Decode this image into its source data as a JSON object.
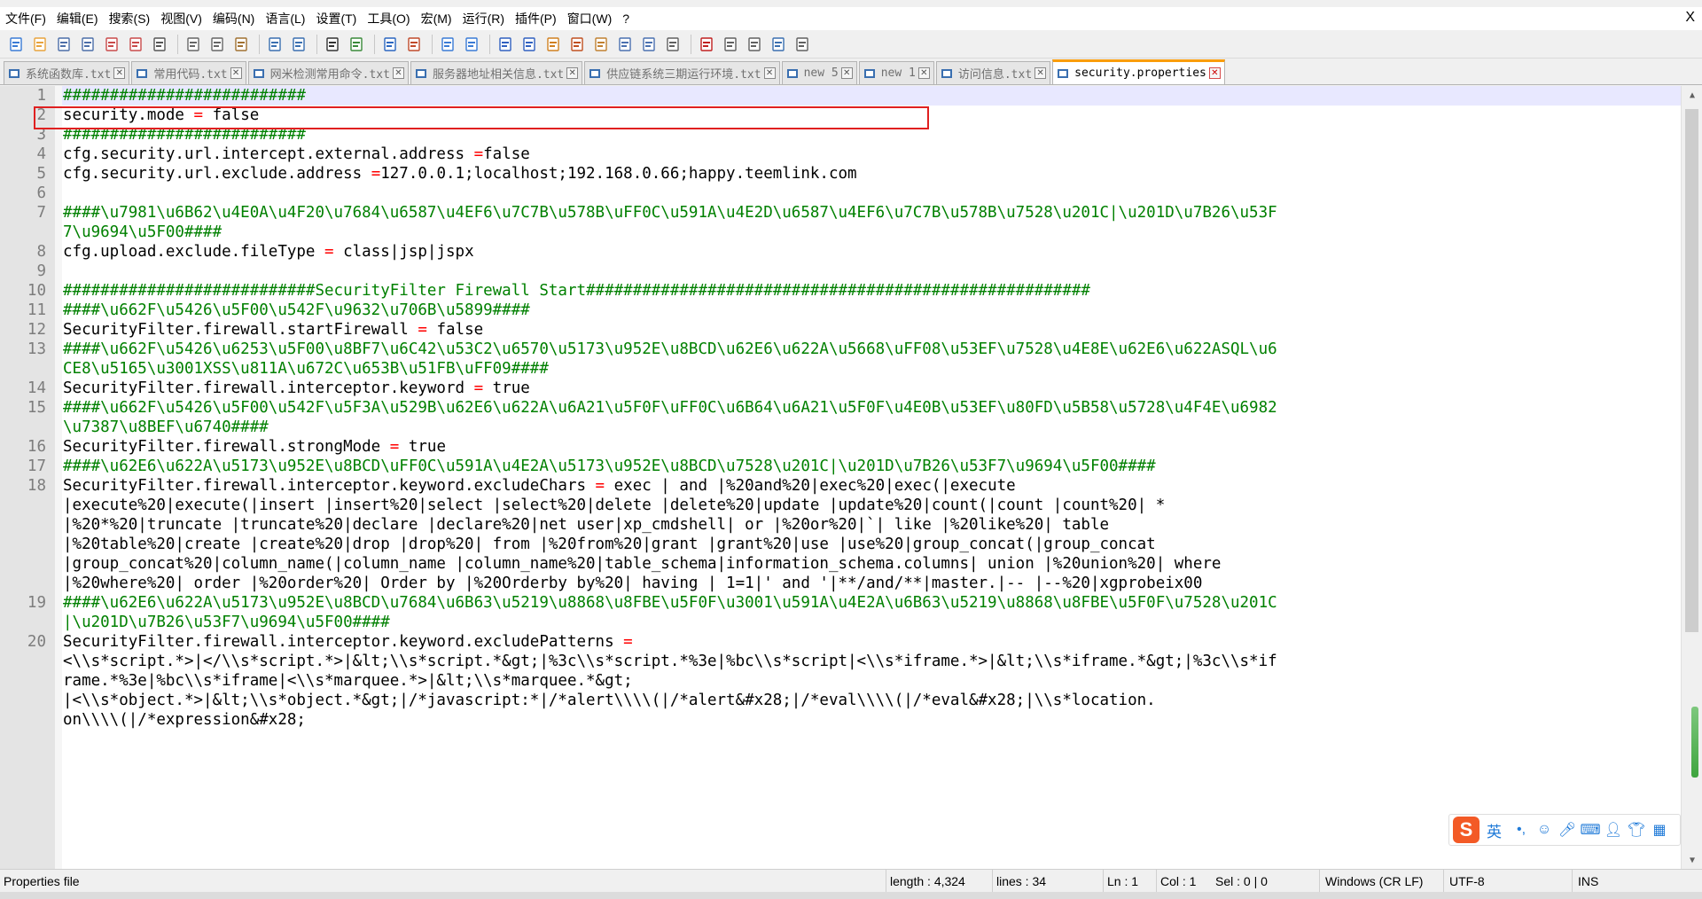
{
  "menubar": {
    "items": [
      "文件(F)",
      "编辑(E)",
      "搜索(S)",
      "视图(V)",
      "编码(N)",
      "语言(L)",
      "设置(T)",
      "工具(O)",
      "宏(M)",
      "运行(R)",
      "插件(P)",
      "窗口(W)",
      "?"
    ],
    "close": "X"
  },
  "toolbar": {
    "icons": [
      "new-file",
      "open-file",
      "save",
      "save-all",
      "close",
      "close-all",
      "print",
      "cut",
      "copy",
      "paste",
      "undo",
      "redo",
      "find",
      "replace",
      "zoom-in",
      "zoom-out",
      "sync-vertical",
      "sync-horizontal",
      "word-wrap",
      "show-all-chars",
      "indent-guide",
      "user-defined-language",
      "doc-map",
      "function-list",
      "folder-workspace",
      "monitoring",
      "record-macro",
      "stop-macro",
      "play-macro",
      "run-macro-multiple",
      "save-macro"
    ]
  },
  "tabs": [
    {
      "label": "系统函数库.txt",
      "active": false
    },
    {
      "label": "常用代码.txt",
      "active": false
    },
    {
      "label": "网米检测常用命令.txt",
      "active": false
    },
    {
      "label": "服务器地址相关信息.txt",
      "active": false
    },
    {
      "label": "供应链系统三期运行环境.txt",
      "active": false
    },
    {
      "label": "new 5",
      "active": false
    },
    {
      "label": "new 1",
      "active": false
    },
    {
      "label": "访问信息.txt",
      "active": false
    },
    {
      "label": "security.properties",
      "active": true
    }
  ],
  "editor": {
    "current_line": 1,
    "lines": [
      {
        "n": "1",
        "wrapped": [
          [
            [
              "c-comment",
              "##########################"
            ]
          ]
        ]
      },
      {
        "n": "2",
        "wrapped": [
          [
            [
              "c-key",
              "security.mode "
            ],
            [
              "c-op",
              "="
            ],
            [
              "c-val",
              " false"
            ]
          ]
        ]
      },
      {
        "n": "3",
        "wrapped": [
          [
            [
              "c-comment",
              "##########################"
            ]
          ]
        ]
      },
      {
        "n": "4",
        "wrapped": [
          [
            [
              "c-key",
              "cfg.security.url.intercept.external.address "
            ],
            [
              "c-op",
              "="
            ],
            [
              "c-val",
              "false"
            ]
          ]
        ]
      },
      {
        "n": "5",
        "wrapped": [
          [
            [
              "c-key",
              "cfg.security.url.exclude.address "
            ],
            [
              "c-op",
              "="
            ],
            [
              "c-val",
              "127.0.0.1;localhost;192.168.0.66;happy.teemlink.com"
            ]
          ]
        ]
      },
      {
        "n": "6",
        "wrapped": [
          [
            [
              "c-val",
              ""
            ]
          ]
        ]
      },
      {
        "n": "7",
        "wrapped": [
          [
            [
              "c-comment",
              "####\\u7981\\u6B62\\u4E0A\\u4F20\\u7684\\u6587\\u4EF6\\u7C7B\\u578B\\uFF0C\\u591A\\u4E2D\\u6587\\u4EF6\\u7C7B\\u578B\\u7528\\u201C|\\u201D\\u7B26\\u53F"
            ]
          ],
          [
            [
              "c-comment",
              "7\\u9694\\u5F00####"
            ]
          ]
        ]
      },
      {
        "n": "8",
        "wrapped": [
          [
            [
              "c-key",
              "cfg.upload.exclude.fileType "
            ],
            [
              "c-op",
              "="
            ],
            [
              "c-val",
              " class|jsp|jspx"
            ]
          ]
        ]
      },
      {
        "n": "9",
        "wrapped": [
          [
            [
              "c-val",
              ""
            ]
          ]
        ]
      },
      {
        "n": "10",
        "wrapped": [
          [
            [
              "c-comment",
              "###########################SecurityFilter Firewall Start######################################################"
            ]
          ]
        ]
      },
      {
        "n": "11",
        "wrapped": [
          [
            [
              "c-comment",
              "####\\u662F\\u5426\\u5F00\\u542F\\u9632\\u706B\\u5899####"
            ]
          ]
        ]
      },
      {
        "n": "12",
        "wrapped": [
          [
            [
              "c-key",
              "SecurityFilter.firewall.startFirewall "
            ],
            [
              "c-op",
              "="
            ],
            [
              "c-val",
              " false"
            ]
          ]
        ]
      },
      {
        "n": "13",
        "wrapped": [
          [
            [
              "c-comment",
              "####\\u662F\\u5426\\u6253\\u5F00\\u8BF7\\u6C42\\u53C2\\u6570\\u5173\\u952E\\u8BCD\\u62E6\\u622A\\u5668\\uFF08\\u53EF\\u7528\\u4E8E\\u62E6\\u622ASQL\\u6"
            ]
          ],
          [
            [
              "c-comment",
              "CE8\\u5165\\u3001XSS\\u811A\\u672C\\u653B\\u51FB\\uFF09####"
            ]
          ]
        ]
      },
      {
        "n": "14",
        "wrapped": [
          [
            [
              "c-key",
              "SecurityFilter.firewall.interceptor.keyword "
            ],
            [
              "c-op",
              "="
            ],
            [
              "c-val",
              " true"
            ]
          ]
        ]
      },
      {
        "n": "15",
        "wrapped": [
          [
            [
              "c-comment",
              "####\\u662F\\u5426\\u5F00\\u542F\\u5F3A\\u529B\\u62E6\\u622A\\u6A21\\u5F0F\\uFF0C\\u6B64\\u6A21\\u5F0F\\u4E0B\\u53EF\\u80FD\\u5B58\\u5728\\u4F4E\\u6982"
            ]
          ],
          [
            [
              "c-comment",
              "\\u7387\\u8BEF\\u6740####"
            ]
          ]
        ]
      },
      {
        "n": "16",
        "wrapped": [
          [
            [
              "c-key",
              "SecurityFilter.firewall.strongMode "
            ],
            [
              "c-op",
              "="
            ],
            [
              "c-val",
              " true"
            ]
          ]
        ]
      },
      {
        "n": "17",
        "wrapped": [
          [
            [
              "c-comment",
              "####\\u62E6\\u622A\\u5173\\u952E\\u8BCD\\uFF0C\\u591A\\u4E2A\\u5173\\u952E\\u8BCD\\u7528\\u201C|\\u201D\\u7B26\\u53F7\\u9694\\u5F00####"
            ]
          ]
        ]
      },
      {
        "n": "18",
        "wrapped": [
          [
            [
              "c-key",
              "SecurityFilter.firewall.interceptor.keyword.excludeChars "
            ],
            [
              "c-op",
              "="
            ],
            [
              "c-val",
              " exec | and |%20and%20|exec%20|exec(|execute"
            ]
          ],
          [
            [
              "c-val",
              "|execute%20|execute(|insert |insert%20|select |select%20|delete |delete%20|update |update%20|count(|count |count%20| *"
            ]
          ],
          [
            [
              "c-val",
              "|%20*%20|truncate |truncate%20|declare |declare%20|net user|xp_cmdshell| or |%20or%20|`| like |%20like%20| table"
            ]
          ],
          [
            [
              "c-val",
              "|%20table%20|create |create%20|drop |drop%20| from |%20from%20|grant |grant%20|use |use%20|group_concat(|group_concat"
            ]
          ],
          [
            [
              "c-val",
              "|group_concat%20|column_name(|column_name |column_name%20|table_schema|information_schema.columns| union |%20union%20| where"
            ]
          ],
          [
            [
              "c-val",
              "|%20where%20| order |%20order%20| Order by |%20Orderby by%20| having | 1=1|' and '|**/and/**|master.|-- |--%20|xgprobeix00"
            ]
          ]
        ]
      },
      {
        "n": "19",
        "wrapped": [
          [
            [
              "c-comment",
              "####\\u62E6\\u622A\\u5173\\u952E\\u8BCD\\u7684\\u6B63\\u5219\\u8868\\u8FBE\\u5F0F\\u3001\\u591A\\u4E2A\\u6B63\\u5219\\u8868\\u8FBE\\u5F0F\\u7528\\u201C"
            ]
          ],
          [
            [
              "c-comment",
              "|\\u201D\\u7B26\\u53F7\\u9694\\u5F00####"
            ]
          ]
        ]
      },
      {
        "n": "20",
        "wrapped": [
          [
            [
              "c-key",
              "SecurityFilter.firewall.interceptor.keyword.excludePatterns "
            ],
            [
              "c-op",
              "="
            ]
          ],
          [
            [
              "c-val",
              "<\\\\s*script.*>|</\\\\s*script.*>|&lt;\\\\s*script.*&gt;|%3c\\\\s*script.*%3e|%bc\\\\s*script|<\\\\s*iframe.*>|&lt;\\\\s*iframe.*&gt;|%3c\\\\s*if"
            ]
          ],
          [
            [
              "c-val",
              "rame.*%3e|%bc\\\\s*iframe|<\\\\s*marquee.*>|&lt;\\\\s*marquee.*&gt;"
            ]
          ],
          [
            [
              "c-val",
              "|<\\\\s*object.*>|&lt;\\\\s*object.*&gt;|/*javascript:*|/*alert\\\\\\\\(|/*alert&#x28;|/*eval\\\\\\\\(|/*eval&#x28;|\\\\s*location."
            ]
          ],
          [
            [
              "c-val",
              "on\\\\\\\\(|/*expression&#x28;"
            ]
          ]
        ]
      }
    ]
  },
  "ime": {
    "label": "英"
  },
  "statusbar": {
    "filetype": "Properties file",
    "length": "length : 4,324",
    "lines": "lines : 34",
    "ln": "Ln : 1",
    "col": "Col : 1",
    "sel": "Sel : 0 | 0",
    "eol": "Windows (CR LF)",
    "encoding": "UTF-8",
    "mode": "INS"
  }
}
